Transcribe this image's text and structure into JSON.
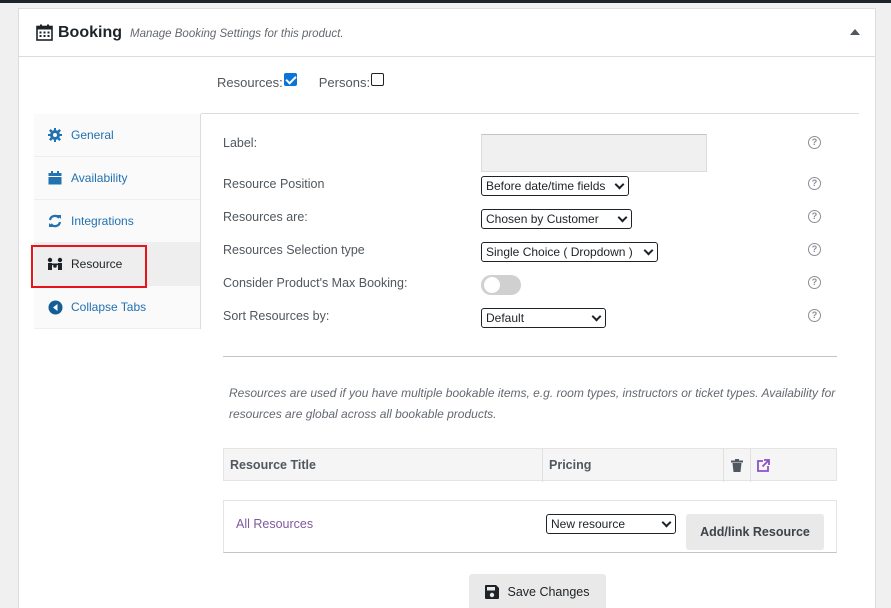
{
  "header": {
    "title": "Booking",
    "description": "Manage Booking Settings for this product."
  },
  "options": {
    "resources_label": "Resources:",
    "resources_checked": true,
    "persons_label": "Persons:",
    "persons_checked": false
  },
  "tabs": [
    {
      "label": "General",
      "icon": "gear-icon"
    },
    {
      "label": "Availability",
      "icon": "calendar-icon"
    },
    {
      "label": "Integrations",
      "icon": "sync-icon"
    },
    {
      "label": "Resource",
      "icon": "people-icon",
      "active": true
    },
    {
      "label": "Collapse Tabs",
      "icon": "collapse-arrow-icon"
    }
  ],
  "fields": {
    "label": {
      "label": "Label:",
      "value": ""
    },
    "resource_position": {
      "label": "Resource Position",
      "value": "Before date/time fields"
    },
    "resources_are": {
      "label": "Resources are:",
      "value": "Chosen by Customer"
    },
    "selection_type": {
      "label": "Resources Selection type",
      "value": "Single Choice ( Dropdown )"
    },
    "max_booking": {
      "label": "Consider Product's Max Booking:",
      "enabled": false
    },
    "sort_by": {
      "label": "Sort Resources by:",
      "value": "Default"
    }
  },
  "help_glyph": "?",
  "note": "Resources are used if you have multiple bookable items, e.g. room types, instructors or ticket types. Availability for resources are global across all bookable products.",
  "table": {
    "col_title": "Resource Title",
    "col_pricing": "Pricing"
  },
  "add_row": {
    "all_link": "All Resources",
    "select_value": "New resource",
    "add_button": "Add/link Resource"
  },
  "save_button": "Save Changes",
  "colors": {
    "accent": "#2271b1",
    "highlight": "#e8141c",
    "link_purple": "#7e5a9e"
  }
}
